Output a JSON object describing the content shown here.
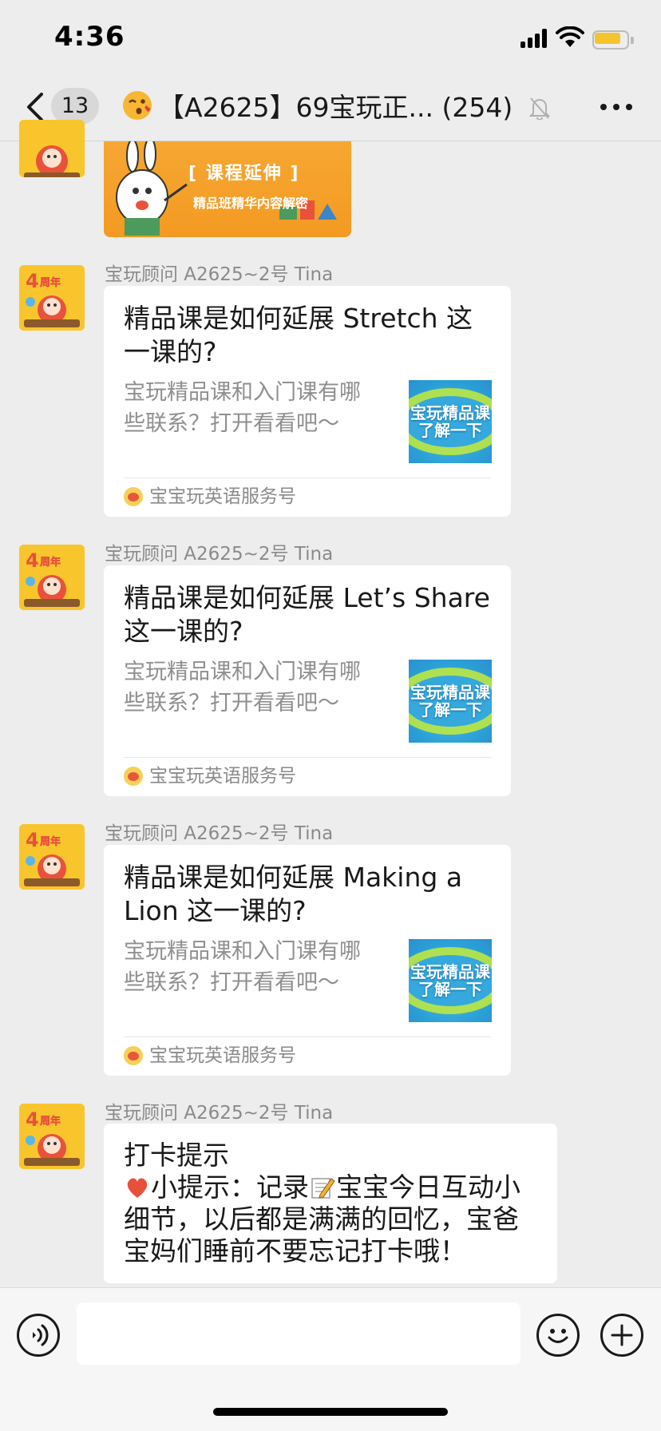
{
  "status_bar": {
    "time": "4:36",
    "battery_color": "#f4c430"
  },
  "nav": {
    "unread_count": "13",
    "title": "【A2625】69宝玩正... (254)",
    "title_emoji": "kissing-face-emoji",
    "muted": true
  },
  "top_image": {
    "tag": "[ 课程延伸 ]",
    "subtitle": "精品班精华内容解密"
  },
  "messages": [
    {
      "sender": "宝玩顾问 A2625~2号 Tina",
      "title": "精品课是如何延展 Stretch 这一课的?",
      "description": "宝玩精品课和入门课有哪些联系？打开看看吧～",
      "thumbnail_text": "宝玩精品课 了解一下",
      "source": "宝宝玩英语服务号"
    },
    {
      "sender": "宝玩顾问 A2625~2号 Tina",
      "title": "精品课是如何延展 Let’s Share 这一课的?",
      "description": "宝玩精品课和入门课有哪些联系？打开看看吧～",
      "thumbnail_text": "宝玩精品课 了解一下",
      "source": "宝宝玩英语服务号"
    },
    {
      "sender": "宝玩顾问 A2625~2号 Tina",
      "title": "精品课是如何延展 Making a Lion 这一课的?",
      "description": "宝玩精品课和入门课有哪些联系？打开看看吧～",
      "thumbnail_text": "宝玩精品课 了解一下",
      "source": "宝宝玩英语服务号"
    }
  ],
  "text_message": {
    "sender": "宝玩顾问 A2625~2号 Tina",
    "line1": "打卡提示",
    "part_a": "小提示：记录",
    "part_b": "宝宝今日互动小细节，以后都是满满的回忆，宝爸宝妈们睡前不要忘记打卡哦！"
  },
  "input": {
    "value": "",
    "placeholder": ""
  }
}
